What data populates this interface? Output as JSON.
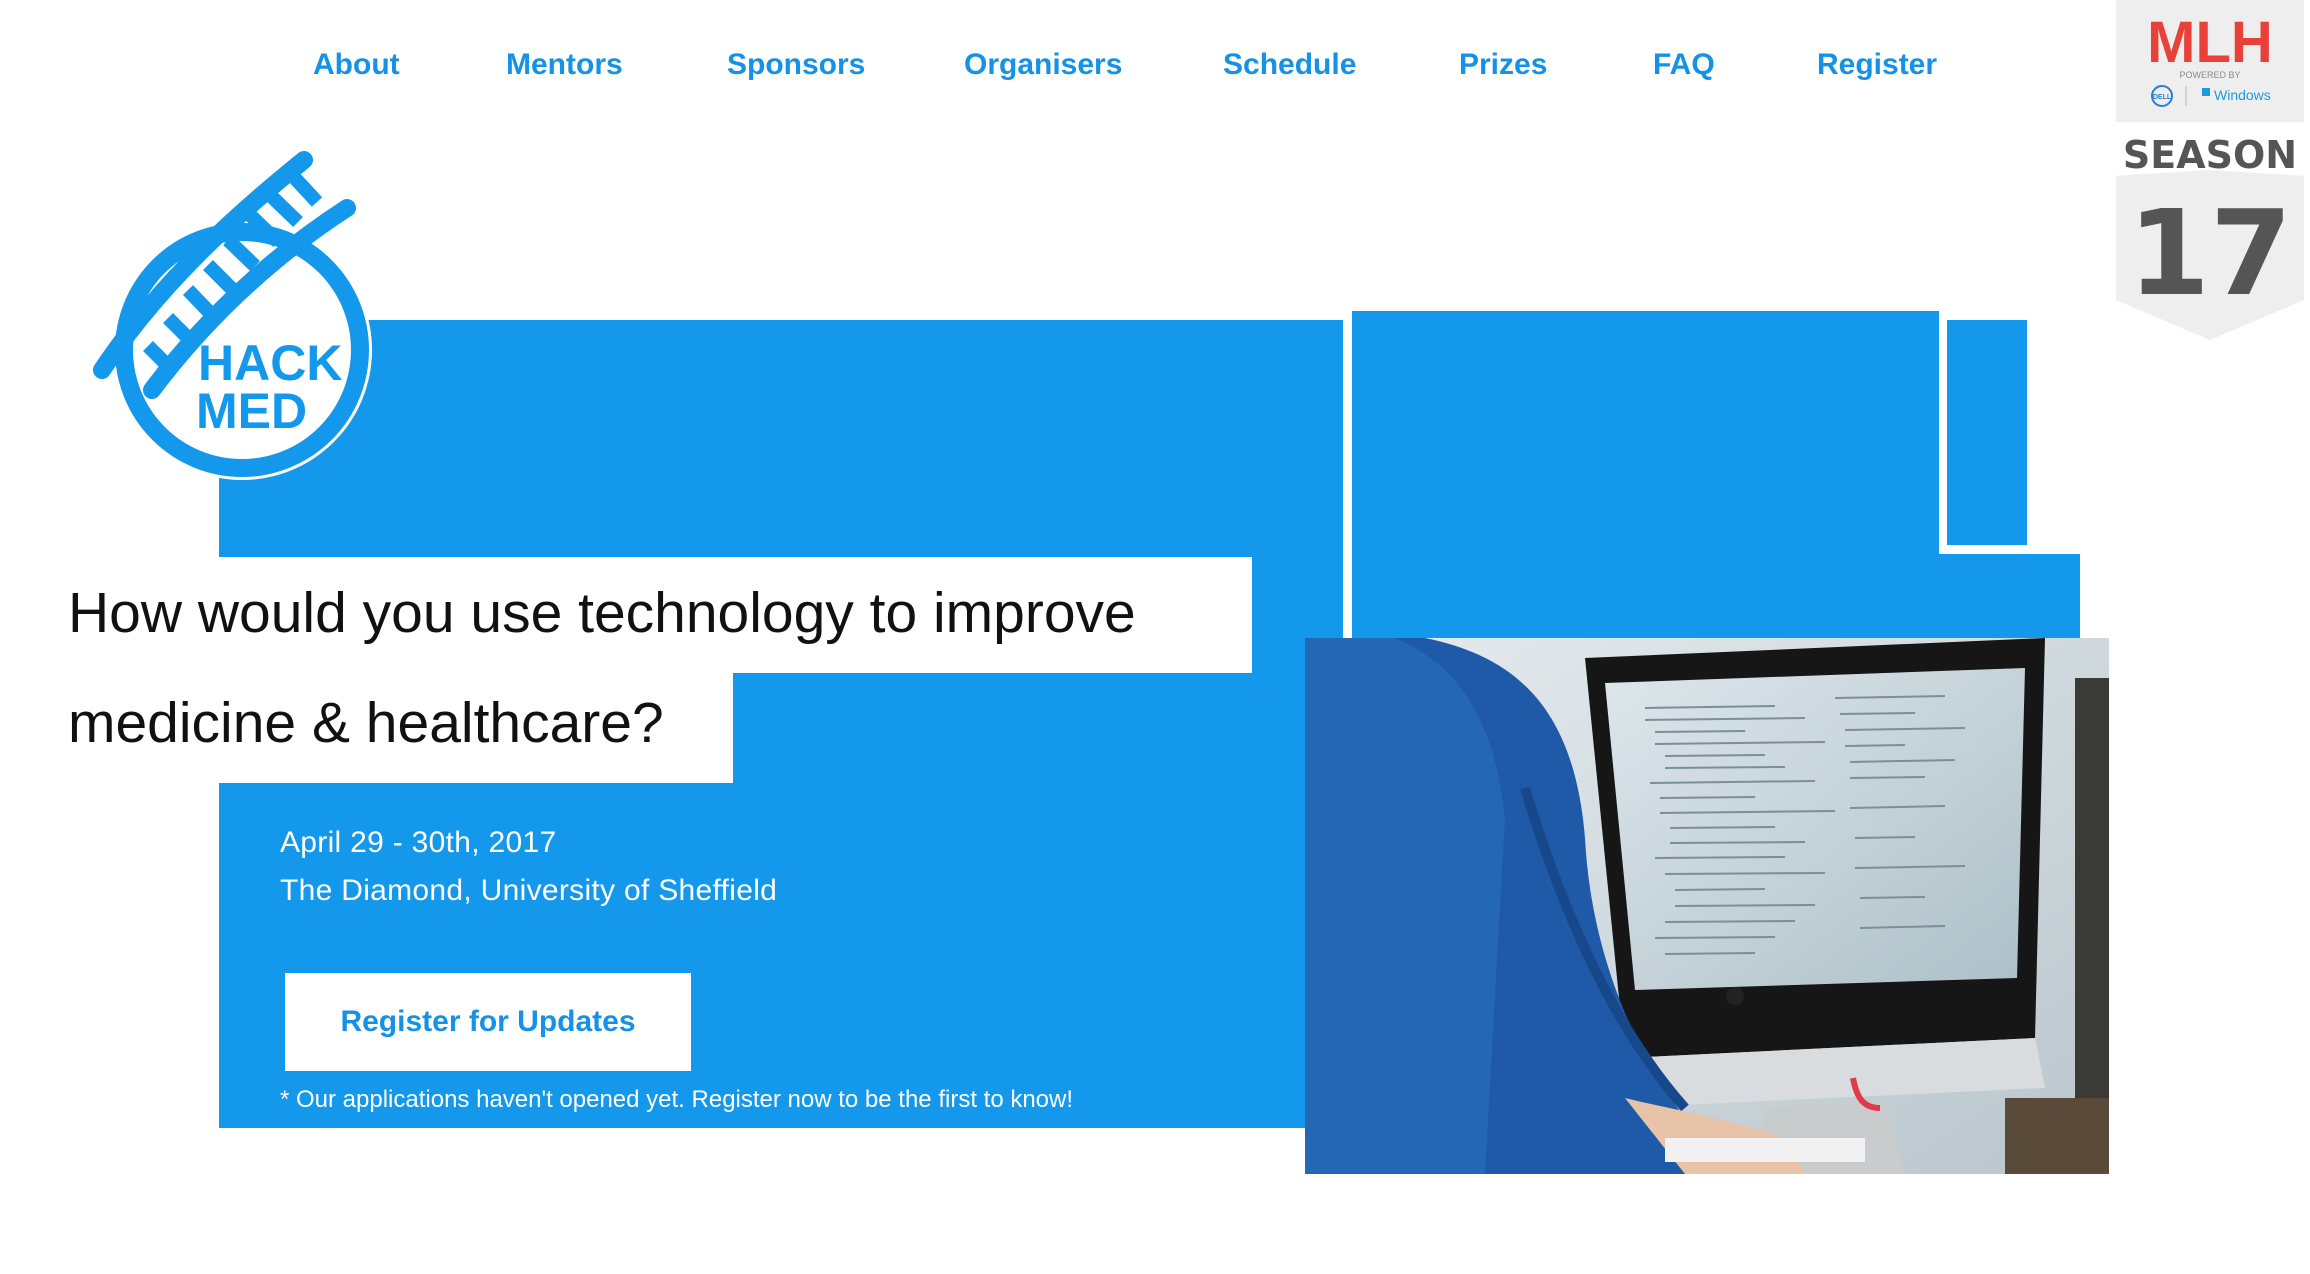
{
  "nav": {
    "items": [
      {
        "label": "About"
      },
      {
        "label": "Mentors"
      },
      {
        "label": "Sponsors"
      },
      {
        "label": "Organisers"
      },
      {
        "label": "Schedule"
      },
      {
        "label": "Prizes"
      },
      {
        "label": "FAQ"
      },
      {
        "label": "Register"
      }
    ]
  },
  "logo": {
    "line1": "HACK",
    "line2": "MED"
  },
  "hero": {
    "headline_line1": "How would you use technology to improve",
    "headline_line2": "medicine & healthcare?",
    "date": "April 29 - 30th, 2017",
    "venue": "The Diamond, University of Sheffield",
    "cta_label": "Register for Updates",
    "note": "* Our applications haven't opened yet. Register now to be the first to know!"
  },
  "badge": {
    "brand": "MLH",
    "powered_by": "POWERED BY",
    "sponsor1": "DELL",
    "sponsor2": "Windows",
    "season_label": "SEASON",
    "season_number": "17"
  },
  "colors": {
    "accent": "#1398eb",
    "nav_text": "#1592e6",
    "headline": "#111111"
  }
}
